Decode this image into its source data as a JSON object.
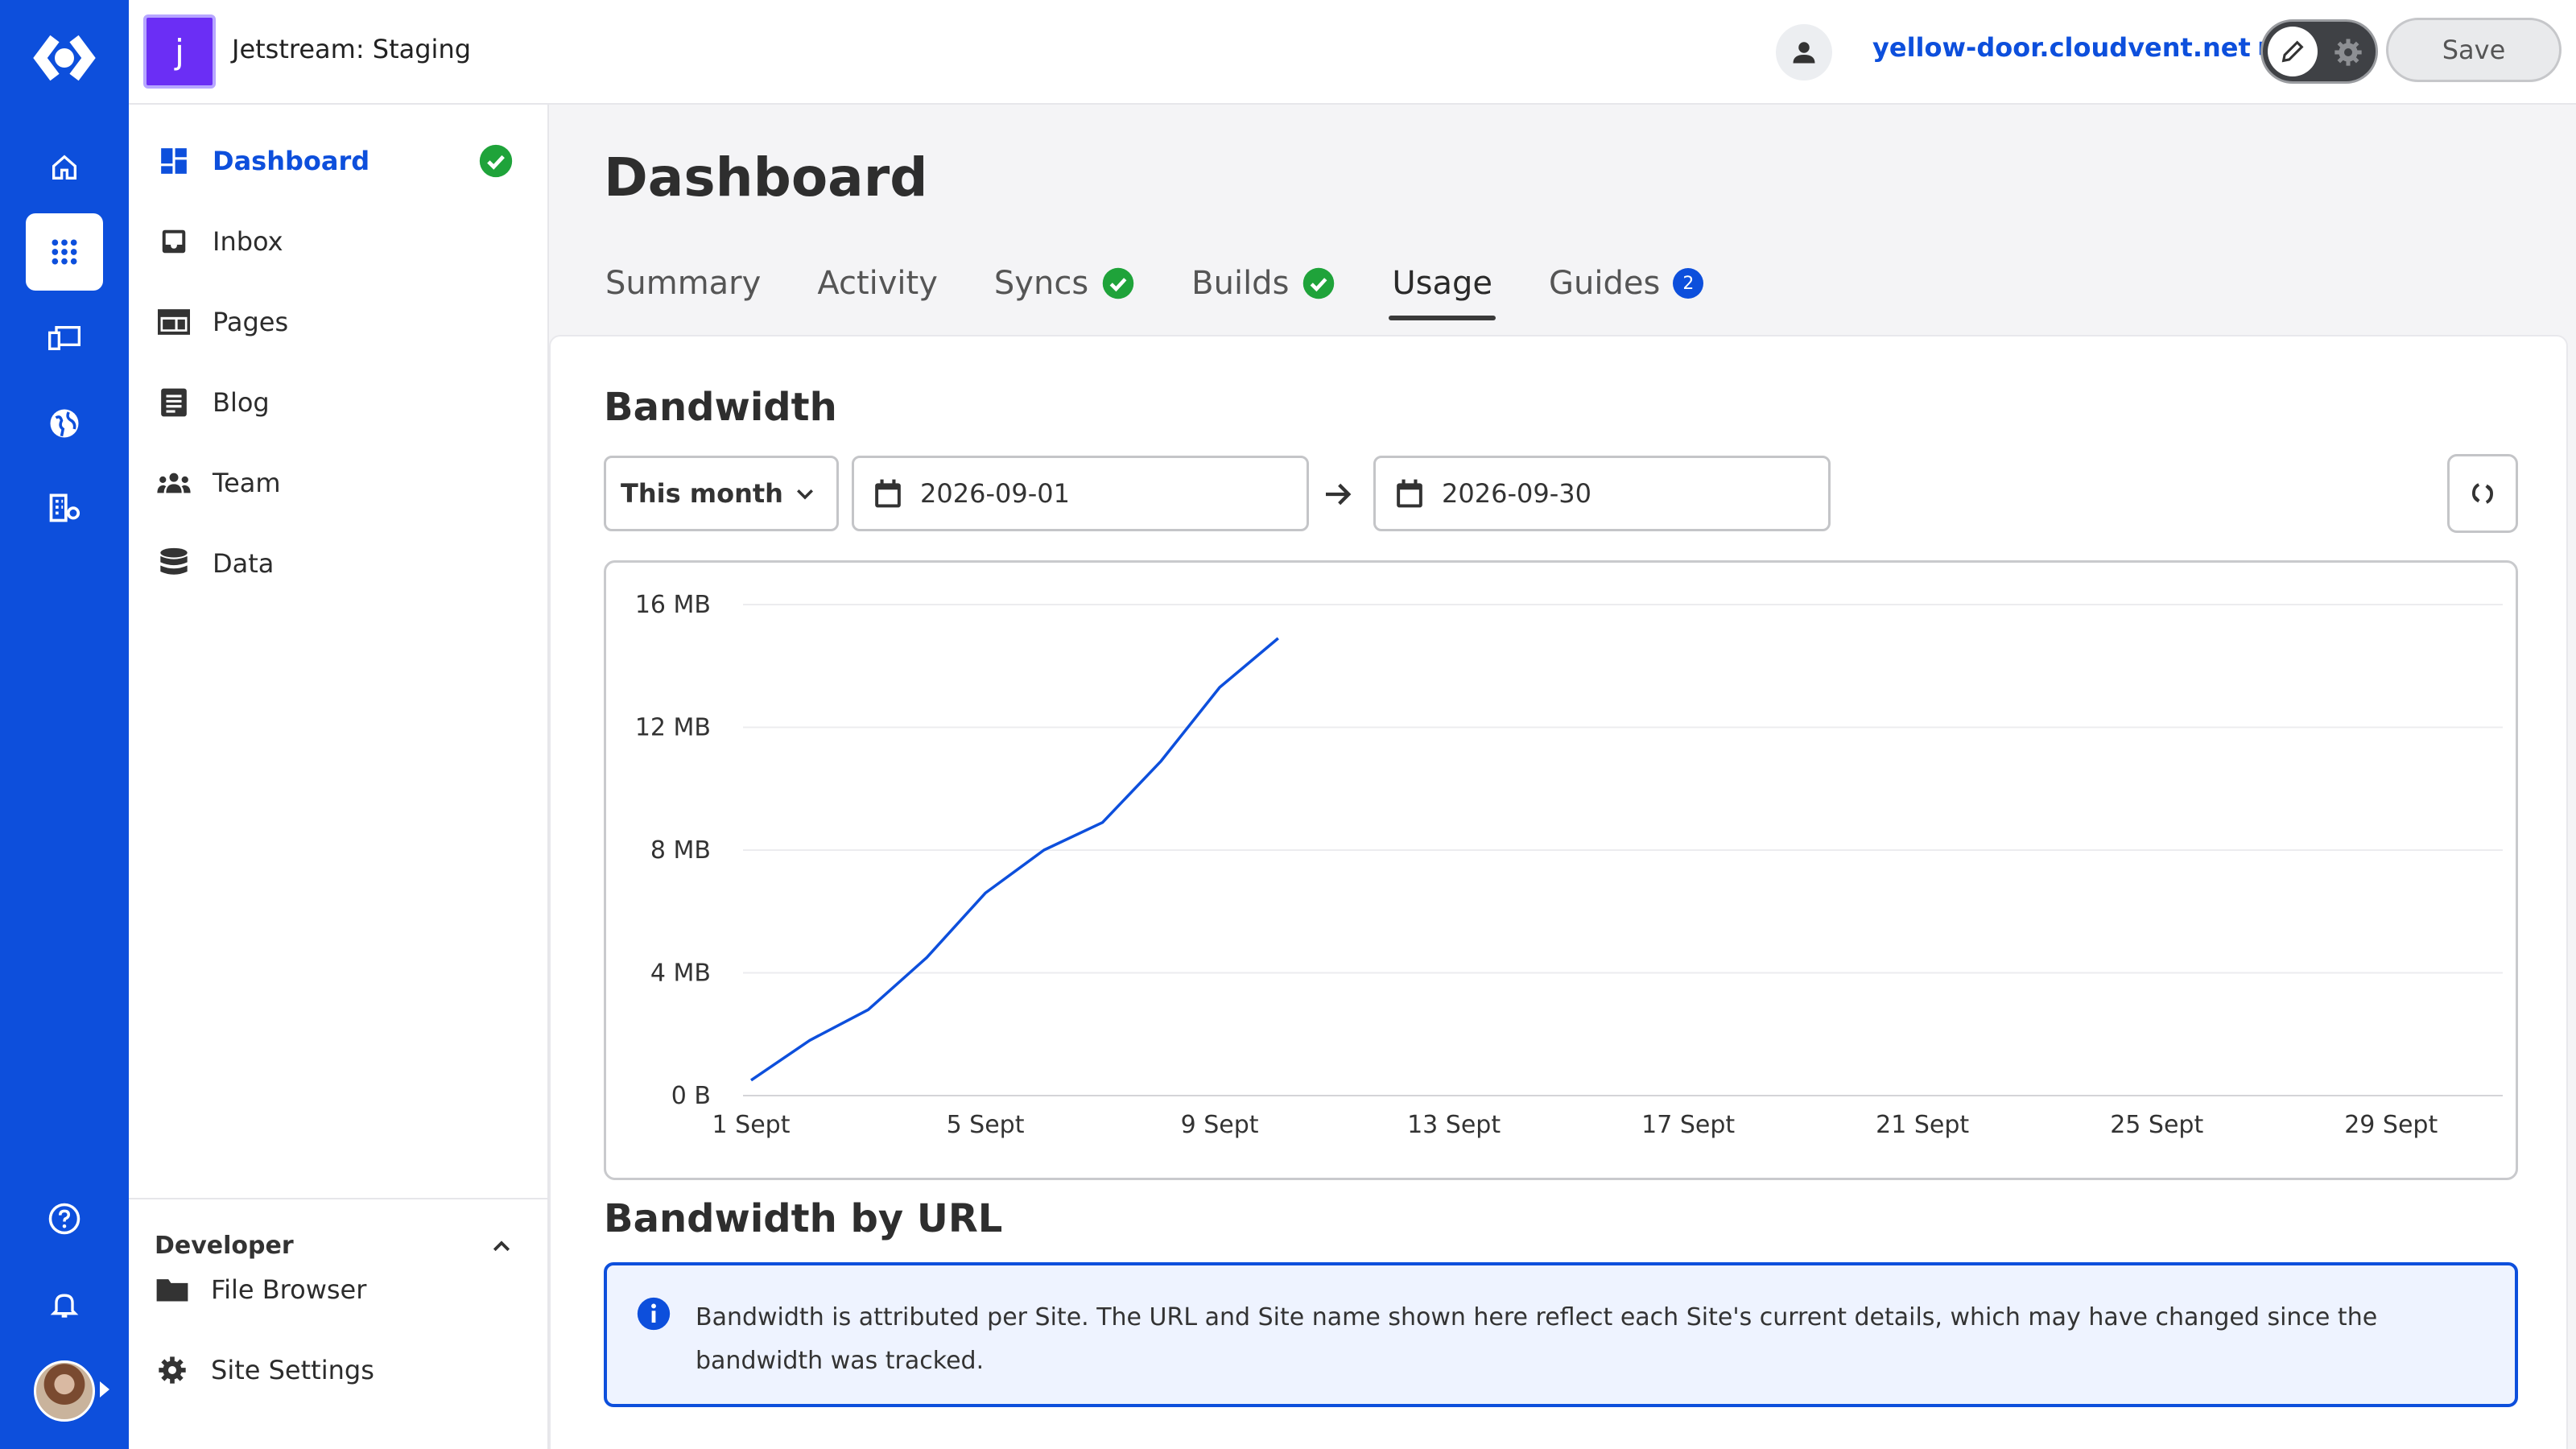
{
  "topbar": {
    "site_initial": "j",
    "site_name": "Jetstream: Staging",
    "site_link": "yellow-door.cloudvent.net",
    "save_label": "Save"
  },
  "sidenav": {
    "items": [
      {
        "label": "Dashboard",
        "icon": "dashboard-icon",
        "active": true,
        "status": "check-circle-icon"
      },
      {
        "label": "Inbox",
        "icon": "inbox-icon"
      },
      {
        "label": "Pages",
        "icon": "pages-icon"
      },
      {
        "label": "Blog",
        "icon": "blog-icon"
      },
      {
        "label": "Team",
        "icon": "team-icon"
      },
      {
        "label": "Data",
        "icon": "data-icon"
      }
    ],
    "developer": {
      "title": "Developer",
      "items": [
        {
          "label": "File Browser",
          "icon": "folder-icon"
        },
        {
          "label": "Site Settings",
          "icon": "gear-icon"
        }
      ]
    }
  },
  "main": {
    "title": "Dashboard",
    "tabs": [
      {
        "label": "Summary"
      },
      {
        "label": "Activity"
      },
      {
        "label": "Syncs",
        "status": "check-circle-icon"
      },
      {
        "label": "Builds",
        "status": "check-circle-icon"
      },
      {
        "label": "Usage",
        "active": true
      },
      {
        "label": "Guides",
        "badge": "2"
      }
    ],
    "bandwidth": {
      "title": "Bandwidth",
      "range_select": "This month",
      "start_date": "2026-09-01",
      "end_date": "2026-09-30"
    },
    "bandwidth_by_url": {
      "title": "Bandwidth by URL",
      "info": "Bandwidth is attributed per Site. The URL and Site name shown here reflect each Site's current details, which may have changed since the bandwidth was tracked."
    }
  },
  "colors": {
    "rail": "#0d4fdc",
    "accent": "#0d4fdc",
    "success": "#1fa33a",
    "line": "#0d4fdc"
  },
  "chart_data": {
    "type": "line",
    "title": "",
    "xlabel": "",
    "ylabel": "",
    "x_ticks": [
      "1 Sept",
      "5 Sept",
      "9 Sept",
      "13 Sept",
      "17 Sept",
      "21 Sept",
      "25 Sept",
      "29 Sept"
    ],
    "y_ticks": [
      "0 B",
      "4 MB",
      "8 MB",
      "12 MB",
      "16 MB"
    ],
    "ylim": [
      0,
      16
    ],
    "xlim": [
      1,
      30
    ],
    "grid": true,
    "series": [
      {
        "x": [
          1,
          2,
          3,
          4,
          5,
          6,
          7,
          8,
          9,
          10
        ],
        "values": [
          0.5,
          1.8,
          2.8,
          4.5,
          6.6,
          8.0,
          8.9,
          10.9,
          13.3,
          14.9
        ]
      }
    ]
  }
}
